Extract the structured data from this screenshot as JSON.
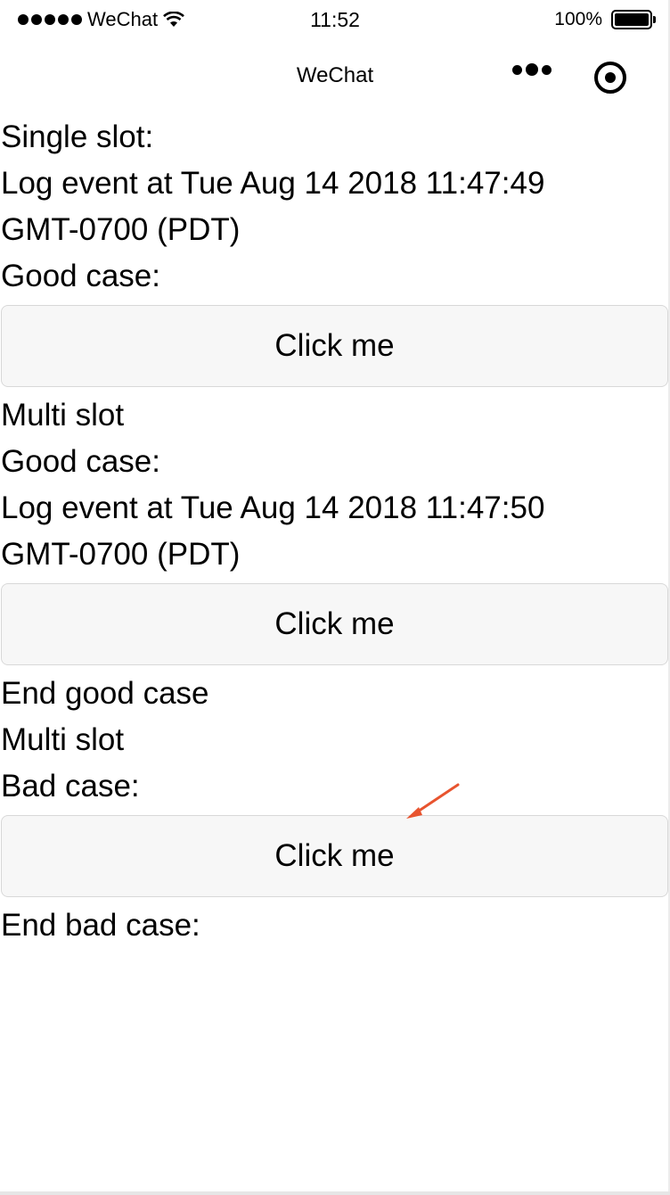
{
  "status_bar": {
    "carrier": "WeChat",
    "time": "11:52",
    "battery": "100%"
  },
  "nav": {
    "title": "WeChat"
  },
  "content": {
    "single_slot_label": "Single slot:",
    "log1_line1": "Log event at Tue Aug 14 2018 11:47:49",
    "log1_line2": "GMT-0700 (PDT)",
    "good_case_label_1": "Good case:",
    "button_1": "Click me",
    "multi_slot_label_1": "Multi slot",
    "good_case_label_2": "Good case:",
    "log2_line1": "Log event at Tue Aug 14 2018 11:47:50",
    "log2_line2": "GMT-0700 (PDT)",
    "button_2": "Click me",
    "end_good_case": "End good case",
    "multi_slot_label_2": "Multi slot",
    "bad_case_label": "Bad case:",
    "button_3": "Click me",
    "end_bad_case": "End bad case:"
  },
  "annotation": {
    "arrow_color": "#e8542f"
  }
}
